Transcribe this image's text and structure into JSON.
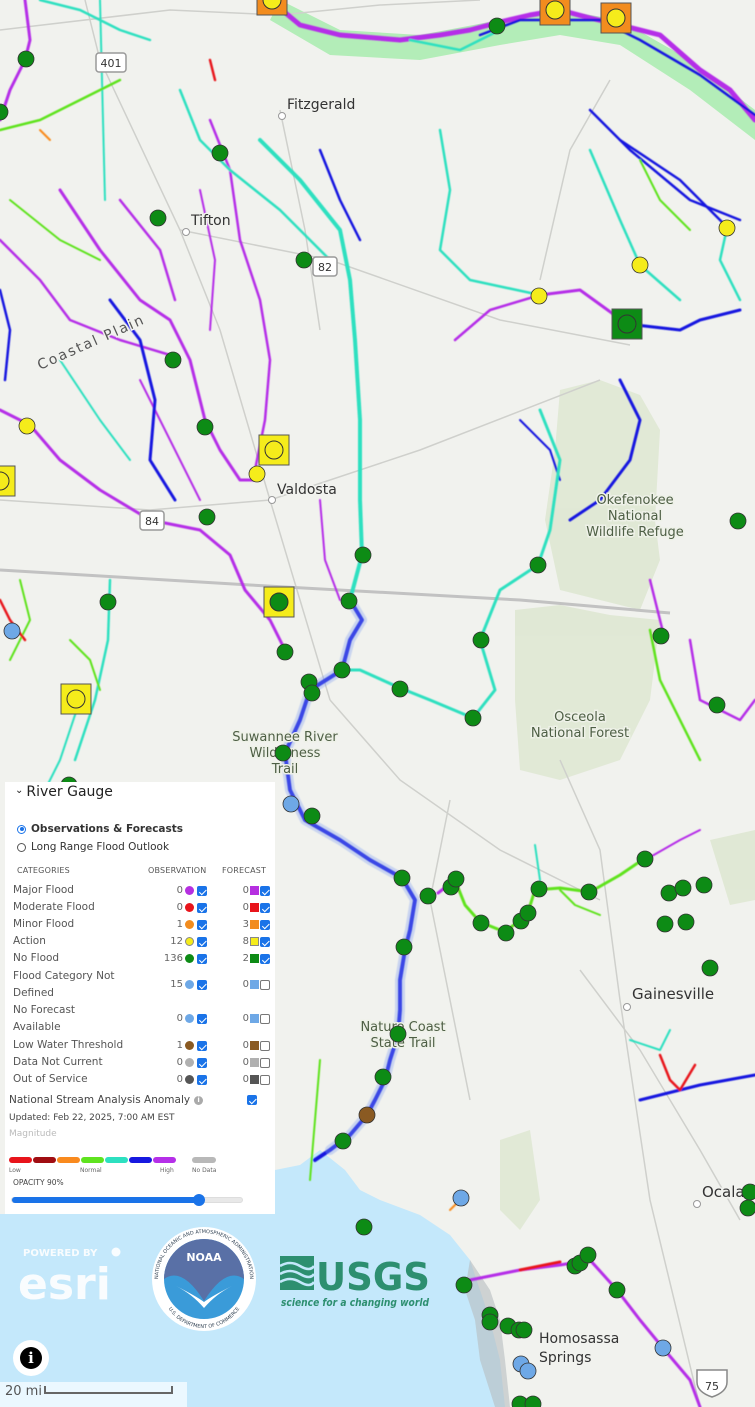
{
  "map": {
    "places": {
      "fitzgerald": "Fitzgerald",
      "tifton": "Tifton",
      "valdosta": "Valdosta",
      "gainesville": "Gainesville",
      "ocala": "Ocala",
      "homosassa_1": "Homosassa",
      "homosassa_2": "Springs",
      "coastal_plain": "Coastal Plain"
    },
    "areas": {
      "okefenokee": [
        "Okefenokee",
        "National",
        "Wildlife Refuge"
      ],
      "osceola": [
        "Osceola",
        "National Forest"
      ],
      "suwannee": [
        "Suwannee River",
        "Wilderness",
        "Trail"
      ],
      "nature_coast": [
        "Nature Coast",
        "State Trail"
      ]
    },
    "shields": {
      "us401": "401",
      "us82": "82",
      "us84": "84",
      "i75": "75"
    },
    "colors": {
      "major": "#b52fe0",
      "moderate": "#e8141b",
      "minor": "#f28c1e",
      "action": "#f5ec1b",
      "no_flood": "#0d8b15",
      "not_defined": "#6ea8e6",
      "low_water": "#8a5a22",
      "data_not_current": "#b0b0b0",
      "out_of_service": "#555555",
      "stream_low": "#e8141b",
      "stream_darkred": "#a00d12",
      "stream_orange": "#f98a1e",
      "stream_green": "#5fe31f",
      "stream_teal": "#2de0c0",
      "stream_blue": "#1719e0",
      "stream_purple": "#b52fe8",
      "water": "#c4e8fb",
      "land": "#f1f2ee"
    }
  },
  "legend": {
    "title": "River Gauge",
    "radio_options": [
      {
        "label": "Observations & Forecasts",
        "selected": true
      },
      {
        "label": "Long Range Flood Outlook",
        "selected": false
      }
    ],
    "headers": {
      "categories": "CATEGORIES",
      "observation": "OBSERVATION",
      "forecast": "FORECAST"
    },
    "categories": [
      {
        "label": "Major Flood",
        "obs": "0",
        "obs_color": "#b52fe0",
        "obs_checked": true,
        "fc": "0",
        "fc_color": "#b52fe0",
        "fc_checked": true
      },
      {
        "label": "Moderate Flood",
        "obs": "0",
        "obs_color": "#e8141b",
        "obs_checked": true,
        "fc": "0",
        "fc_color": "#e8141b",
        "fc_checked": true
      },
      {
        "label": "Minor Flood",
        "obs": "1",
        "obs_color": "#f28c1e",
        "obs_checked": true,
        "fc": "3",
        "fc_color": "#f28c1e",
        "fc_checked": true
      },
      {
        "label": "Action",
        "obs": "12",
        "obs_color": "#f5ec1b",
        "obs_checked": true,
        "fc": "8",
        "fc_color": "#f5ec1b",
        "fc_checked": true
      },
      {
        "label": "No Flood",
        "obs": "136",
        "obs_color": "#0d8b15",
        "obs_checked": true,
        "fc": "2",
        "fc_color": "#0d8b15",
        "fc_checked": true
      },
      {
        "label": "Flood Category Not Defined",
        "obs": "15",
        "obs_color": "#6ea8e6",
        "obs_checked": true,
        "fc": "0",
        "fc_color": "#6ea8e6",
        "fc_checked": false
      },
      {
        "label": "No Forecast Available",
        "obs": "0",
        "obs_color": "#6ea8e6",
        "obs_checked": true,
        "fc": "0",
        "fc_color": "#6ea8e6",
        "fc_checked": false
      },
      {
        "label": "Low Water Threshold",
        "obs": "1",
        "obs_color": "#8a5a22",
        "obs_checked": true,
        "fc": "0",
        "fc_color": "#8a5a22",
        "fc_checked": false
      },
      {
        "label": "Data Not Current",
        "obs": "0",
        "obs_color": "#b0b0b0",
        "obs_checked": true,
        "fc": "0",
        "fc_color": "#b0b0b0",
        "fc_checked": false
      },
      {
        "label": "Out of Service",
        "obs": "0",
        "obs_color": "#555555",
        "obs_checked": true,
        "fc": "0",
        "fc_color": "#555555",
        "fc_checked": false
      }
    ],
    "nsa": {
      "label": "National Stream Analysis Anomaly",
      "checked": true,
      "updated": "Updated: Feb 22, 2025, 7:00 AM EST",
      "magnitude": "Magnitude",
      "ramp_colors": [
        "#e8141b",
        "#a00d12",
        "#f98a1e",
        "#5fe31f",
        "#2de0c0",
        "#1719e0",
        "#b52fe8"
      ],
      "nodata_color": "#b8b8b8",
      "ramp_labels": {
        "low": "Low",
        "normal": "Normal",
        "high": "High",
        "nodata": "No Data"
      }
    },
    "opacity": {
      "label": "OPACITY 90%",
      "value_percent": 90
    }
  },
  "attribution": {
    "esri_top": "POWERED BY",
    "esri": "esri",
    "noaa": "NOAA",
    "noaa_ring_top": "NATIONAL OCEANIC AND ATMOSPHERIC ADMINISTRATION",
    "noaa_ring_bottom": "U.S. DEPARTMENT OF COMMERCE",
    "usgs": "USGS",
    "usgs_tagline": "science for a changing world"
  },
  "scale": {
    "label": "20 mi"
  },
  "info_button": {
    "glyph": "i"
  }
}
